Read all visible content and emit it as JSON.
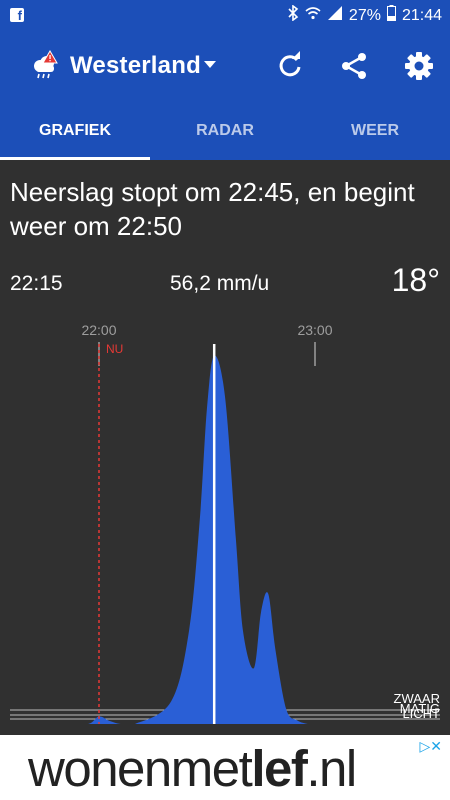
{
  "status_bar": {
    "battery": "27%",
    "time": "21:44",
    "icons": [
      "facebook-icon",
      "bluetooth-icon",
      "wifi-icon",
      "signal-icon",
      "battery-icon"
    ]
  },
  "app_bar": {
    "location": "Westerland",
    "icons": [
      "rain-warning-icon",
      "dropdown-icon",
      "refresh-icon",
      "share-icon",
      "settings-icon"
    ]
  },
  "tabs": [
    {
      "label": "GRAFIEK",
      "active": true
    },
    {
      "label": "RADAR",
      "active": false
    },
    {
      "label": "WEER",
      "active": false
    }
  ],
  "forecast": {
    "message": "Neerslag stopt om 22:45, en begint weer om 22:50",
    "selected_time": "22:15",
    "intensity": "56,2 mm/u",
    "temperature": "18°"
  },
  "chart_data": {
    "type": "area",
    "now_label": "NU",
    "time_ticks": [
      "22:00",
      "23:00"
    ],
    "intensity_levels": [
      "ZWAAR",
      "MATIG",
      "LICHT"
    ],
    "colors": {
      "fill": "#2a5fd6",
      "now_line": "#e53935",
      "cursor": "#ffffff",
      "ticks": "#9e9e9e"
    },
    "x_minutes": [
      -10,
      -3,
      0,
      3,
      6,
      10,
      20,
      25,
      28,
      30,
      32,
      35,
      38,
      40,
      43,
      45,
      47,
      49,
      52,
      55,
      58,
      60
    ],
    "y_relative": [
      0,
      0,
      0.02,
      0.008,
      0,
      0,
      0.06,
      0.25,
      0.55,
      0.85,
      0.99,
      0.88,
      0.5,
      0.25,
      0.15,
      0.3,
      0.35,
      0.2,
      0.04,
      0.01,
      0,
      0
    ]
  },
  "ad": {
    "brand_regular": "wonenmet",
    "brand_bold": "lef",
    "brand_tld": ".nl",
    "adchoices": "▷✕"
  }
}
